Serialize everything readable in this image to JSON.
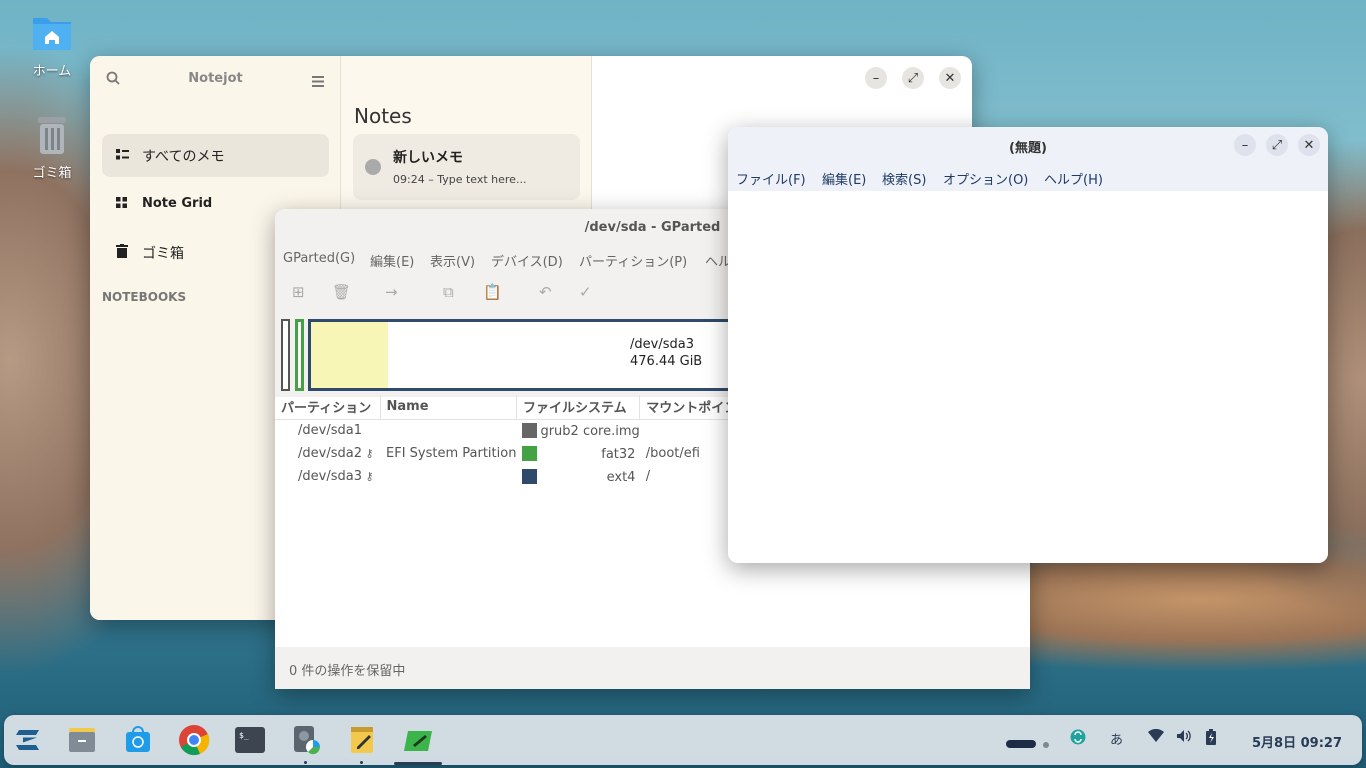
{
  "desktop": {
    "icons": [
      {
        "label": "ホーム",
        "icon": "home-folder-icon"
      },
      {
        "label": "ゴミ箱",
        "icon": "trash-icon"
      }
    ]
  },
  "notejot": {
    "title": "Notejot",
    "nav_items": [
      {
        "label": "すべてのメモ",
        "icon": "list-icon",
        "selected": true
      },
      {
        "label": "Note Grid",
        "icon": "grid-icon",
        "selected": false
      },
      {
        "label": "ゴミ箱",
        "icon": "trash-icon",
        "selected": false
      }
    ],
    "notebooks_header": "NOTEBOOKS",
    "notes_title": "Notes",
    "note": {
      "title": "新しいメモ",
      "subtitle": "09:24 – Type text here..."
    },
    "accent": "#f0ebe2"
  },
  "gparted": {
    "title": "/dev/sda - GParted",
    "menu": [
      "GParted(G)",
      "編集(E)",
      "表示(V)",
      "デバイス(D)",
      "パーティション(P)",
      "ヘルプ(H)"
    ],
    "disk_label": "/dev/sda3",
    "disk_size": "476.44 GiB",
    "columns": [
      "パーティション",
      "Name",
      "ファイルシステム",
      "マウントポイント"
    ],
    "rows": [
      {
        "partition": "/dev/sda1",
        "key": false,
        "name": "",
        "fs_color": "#666666",
        "filesystem": "grub2 core.img",
        "mount": ""
      },
      {
        "partition": "/dev/sda2",
        "key": true,
        "name": "EFI System Partition",
        "fs_color": "#44a244",
        "filesystem": "fat32",
        "mount": "/boot/efi"
      },
      {
        "partition": "/dev/sda3",
        "key": true,
        "name": "",
        "fs_color": "#2f4a6a",
        "filesystem": "ext4",
        "mount": "/"
      }
    ],
    "status": "0 件の操作を保留中"
  },
  "editor": {
    "title": "(無題)",
    "menu": [
      "ファイル(F)",
      "編集(E)",
      "検索(S)",
      "オプション(O)",
      "ヘルプ(H)"
    ]
  },
  "taskbar": {
    "apps": [
      "zorin-menu-icon",
      "files-icon",
      "software-store-icon",
      "chrome-icon",
      "terminal-icon",
      "disk-utility-icon",
      "notes-icon",
      "text-editor-icon"
    ],
    "input_method": "あ",
    "clock": "5月8日 09:27"
  }
}
